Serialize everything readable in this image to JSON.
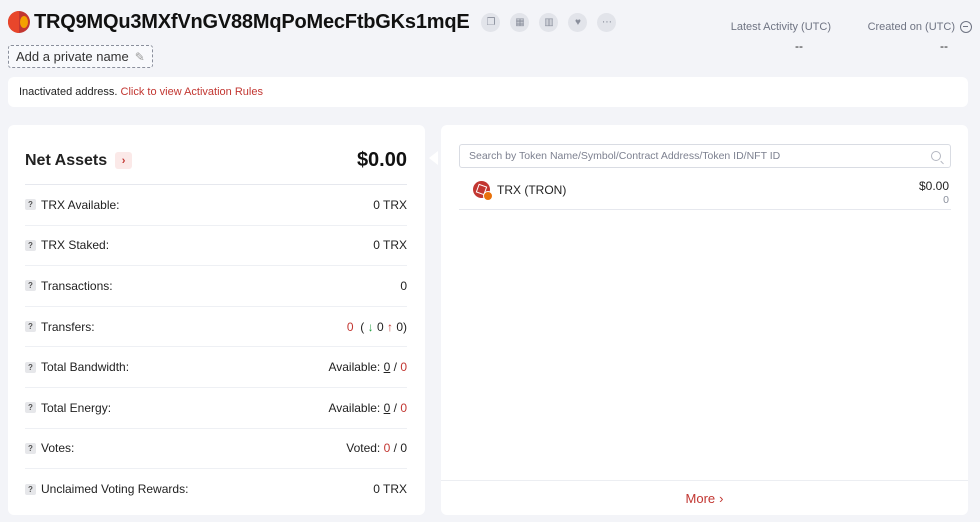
{
  "header": {
    "address": "TRQ9MQu3MXfVnGV88MqPoMecFtbGKs1mqE",
    "private_name_label": "Add a private name",
    "latest_activity_label": "Latest Activity (UTC)",
    "latest_activity_value": "--",
    "created_on_label": "Created on (UTC)",
    "created_on_value": "--",
    "tools": [
      "copy-icon",
      "qr-code-icon",
      "chart-icon",
      "heart-icon",
      "more-icon"
    ]
  },
  "notice": {
    "text": "Inactivated address.",
    "link": "Click to view Activation Rules"
  },
  "net_assets": {
    "title": "Net Assets",
    "value": "$0.00",
    "rows": {
      "trx_available": {
        "label": "TRX Available:",
        "value": "0 TRX"
      },
      "trx_staked": {
        "label": "TRX Staked:",
        "value": "0 TRX"
      },
      "transactions": {
        "label": "Transactions:",
        "value": "0"
      },
      "transfers": {
        "label": "Transfers:",
        "total": "0",
        "in": "0",
        "out": "0"
      },
      "bandwidth": {
        "label": "Total Bandwidth:",
        "prefix": "Available:",
        "available": "0",
        "total": "0"
      },
      "energy": {
        "label": "Total Energy:",
        "prefix": "Available:",
        "available": "0",
        "total": "0"
      },
      "votes": {
        "label": "Votes:",
        "prefix": "Voted:",
        "voted": "0",
        "total": "0"
      },
      "rewards": {
        "label": "Unclaimed Voting Rewards:",
        "value": "0 TRX"
      }
    }
  },
  "tokens": {
    "search_placeholder": "Search by Token Name/Symbol/Contract Address/Token ID/NFT ID",
    "items": [
      {
        "name": "TRX (TRON)",
        "value": "$0.00",
        "amount": "0"
      }
    ],
    "more_label": "More"
  }
}
